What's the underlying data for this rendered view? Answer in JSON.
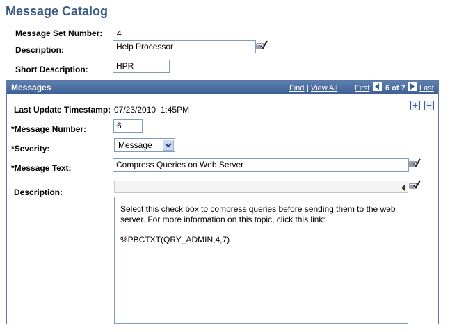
{
  "page": {
    "title": "Message Catalog"
  },
  "header": {
    "message_set_label": "Message Set Number:",
    "message_set_value": "4",
    "description_label": "Description:",
    "description_value": "Help Processor",
    "short_description_label": "Short Description:",
    "short_description_value": "HPR"
  },
  "grid": {
    "title": "Messages",
    "find_label": "Find",
    "separator": "|",
    "view_all_label": "View All",
    "first_label": "First",
    "count_text": "6 of 7",
    "last_label": "Last",
    "add_symbol": "+",
    "remove_symbol": "−"
  },
  "message": {
    "timestamp_label": "Last Update Timestamp:",
    "timestamp_value": "07/23/2010  1:45PM",
    "number_label": "*Message Number:",
    "number_value": "6",
    "severity_label": "*Severity:",
    "severity_value": "Message",
    "text_label": "*Message Text:",
    "text_value": "Compress Queries on Web Server",
    "description_label": "Description:",
    "description_para1": "Select this check box to compress queries before sending them to the web server. For more information on this topic, click this link:",
    "description_para2": "%PBCTXT(QRY_ADMIN,4,7)"
  },
  "icons": {
    "lookup": "lookup-icon",
    "prev": "previous-arrow-icon",
    "next": "next-arrow-icon",
    "dropdown": "chevron-down-icon",
    "expand": "expand-icon"
  },
  "colors": {
    "title": "#3c5a87",
    "grid_header": "#4a6ca1",
    "input_border": "#7f9db9"
  }
}
